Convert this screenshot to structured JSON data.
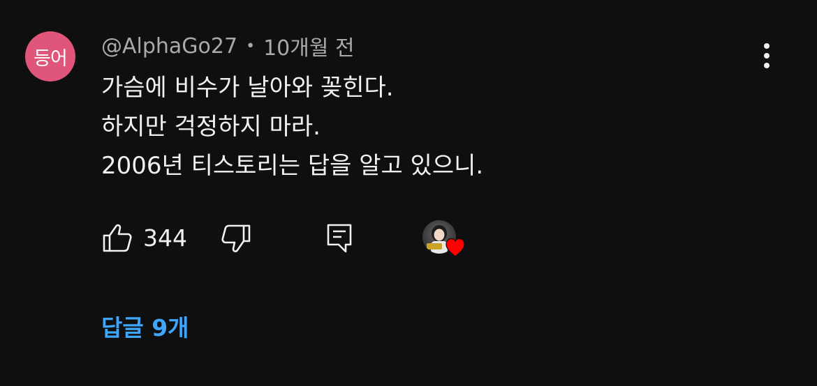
{
  "comment": {
    "avatar_text": "등어",
    "author": "@AlphaGo27",
    "separator": "•",
    "timestamp": "10개월 전",
    "lines": [
      "가슴에 비수가 날아와 꽂힌다.",
      "하지만 걱정하지 마라.",
      "2006년 티스토리는 답을 알고 있으니."
    ],
    "like_count": "344",
    "replies_label": "답글 9개"
  },
  "icons": {
    "more": "more-vertical-icon",
    "like": "thumbs-up-icon",
    "dislike": "thumbs-down-icon",
    "reply": "reply-comment-icon",
    "creator_heart": "heart-icon"
  },
  "colors": {
    "background": "#0f0f0f",
    "avatar": "#e0567b",
    "link": "#3ea6ff",
    "heart": "#ff0000"
  }
}
